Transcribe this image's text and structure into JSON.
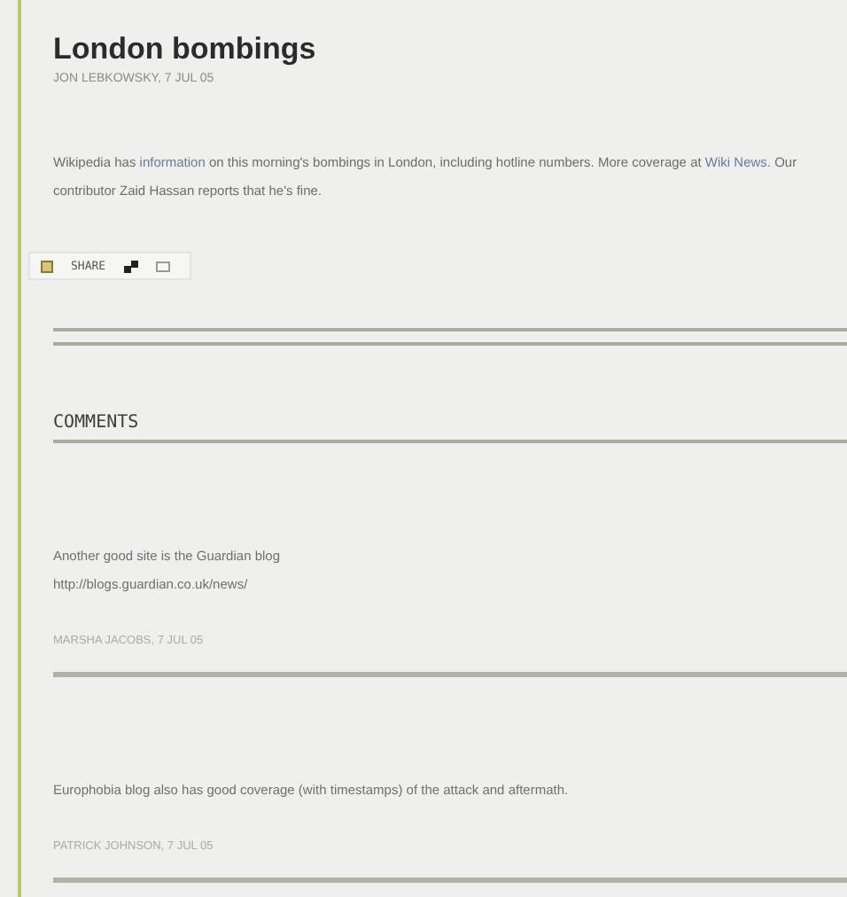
{
  "post": {
    "title": "London bombings",
    "byline": "JON LEBKOWSKY, 7 JUL 05",
    "body": [
      {
        "text": "Wikipedia has ",
        "link": false
      },
      {
        "text": "information",
        "link": true
      },
      {
        "text": " on this morning's bombings in London, including hotline numbers. More coverage at ",
        "link": false
      },
      {
        "text": "Wiki News",
        "link": true
      },
      {
        "text": ". Our contributor Zaid Hassan reports that he's fine.",
        "link": false
      }
    ]
  },
  "share": {
    "label": "SHARE"
  },
  "comments_heading": "COMMENTS",
  "comments": [
    {
      "lines": [
        "Another good site is the Guardian blog",
        "http://blogs.guardian.co.uk/news/"
      ],
      "author": "MARSHA JACOBS, 7 JUL 05"
    },
    {
      "lines": [
        "Europhobia blog also has good coverage (with timestamps) of the attack and aftermath."
      ],
      "author": "PATRICK JOHNSON, 7 JUL 05"
    }
  ]
}
